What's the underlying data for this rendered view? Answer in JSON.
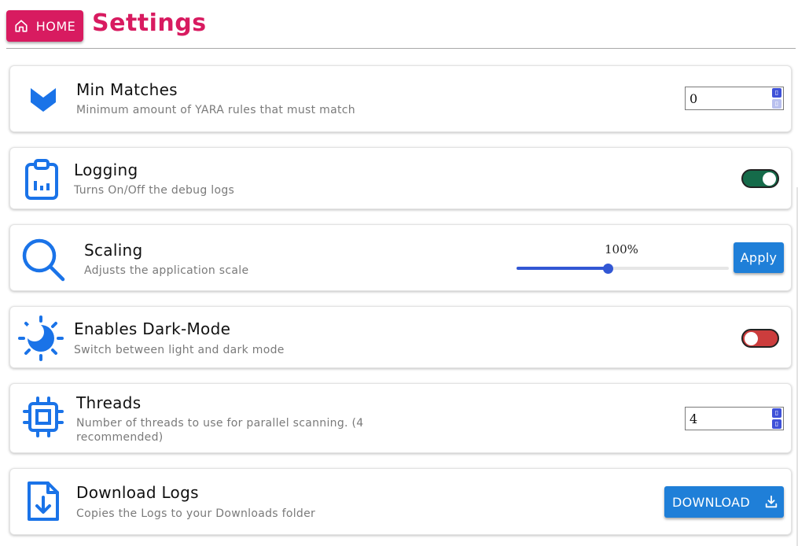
{
  "header": {
    "home_label": "HOME",
    "home_icon": "home-icon",
    "title": "Settings",
    "accent_color": "#d81b60"
  },
  "settings": {
    "min_matches": {
      "label": "Min Matches",
      "description": "Minimum amount of YARA rules that must match",
      "value": "0",
      "icon": "chevron-down-icon"
    },
    "logging": {
      "label": "Logging",
      "description": "Turns On/Off the debug logs",
      "enabled": true,
      "icon": "clipboard-chart-icon",
      "toggle_color": "#156b4a"
    },
    "scaling": {
      "label": "Scaling",
      "description": "Adjusts the application scale",
      "value_text": "100%",
      "slider_fraction": 0.43,
      "apply_label": "Apply",
      "icon": "search-icon"
    },
    "dark_mode": {
      "label": "Enables Dark-Mode",
      "description": "Switch between light and dark mode",
      "enabled": false,
      "icon": "sun-moon-icon",
      "toggle_color": "#cc3d3d"
    },
    "threads": {
      "label": "Threads",
      "description": "Number of threads to use for parallel scanning. (4 recommended)",
      "value": "4",
      "icon": "cpu-icon"
    },
    "download_logs": {
      "label": "Download Logs",
      "description": "Copies the Logs to your Downloads folder",
      "button_label": "DOWNLOAD",
      "icon": "file-download-icon",
      "button_icon": "download-icon"
    }
  },
  "colors": {
    "icon_blue": "#1a73e8",
    "button_blue": "#1f7fd8",
    "slider_blue": "#3257d4"
  }
}
